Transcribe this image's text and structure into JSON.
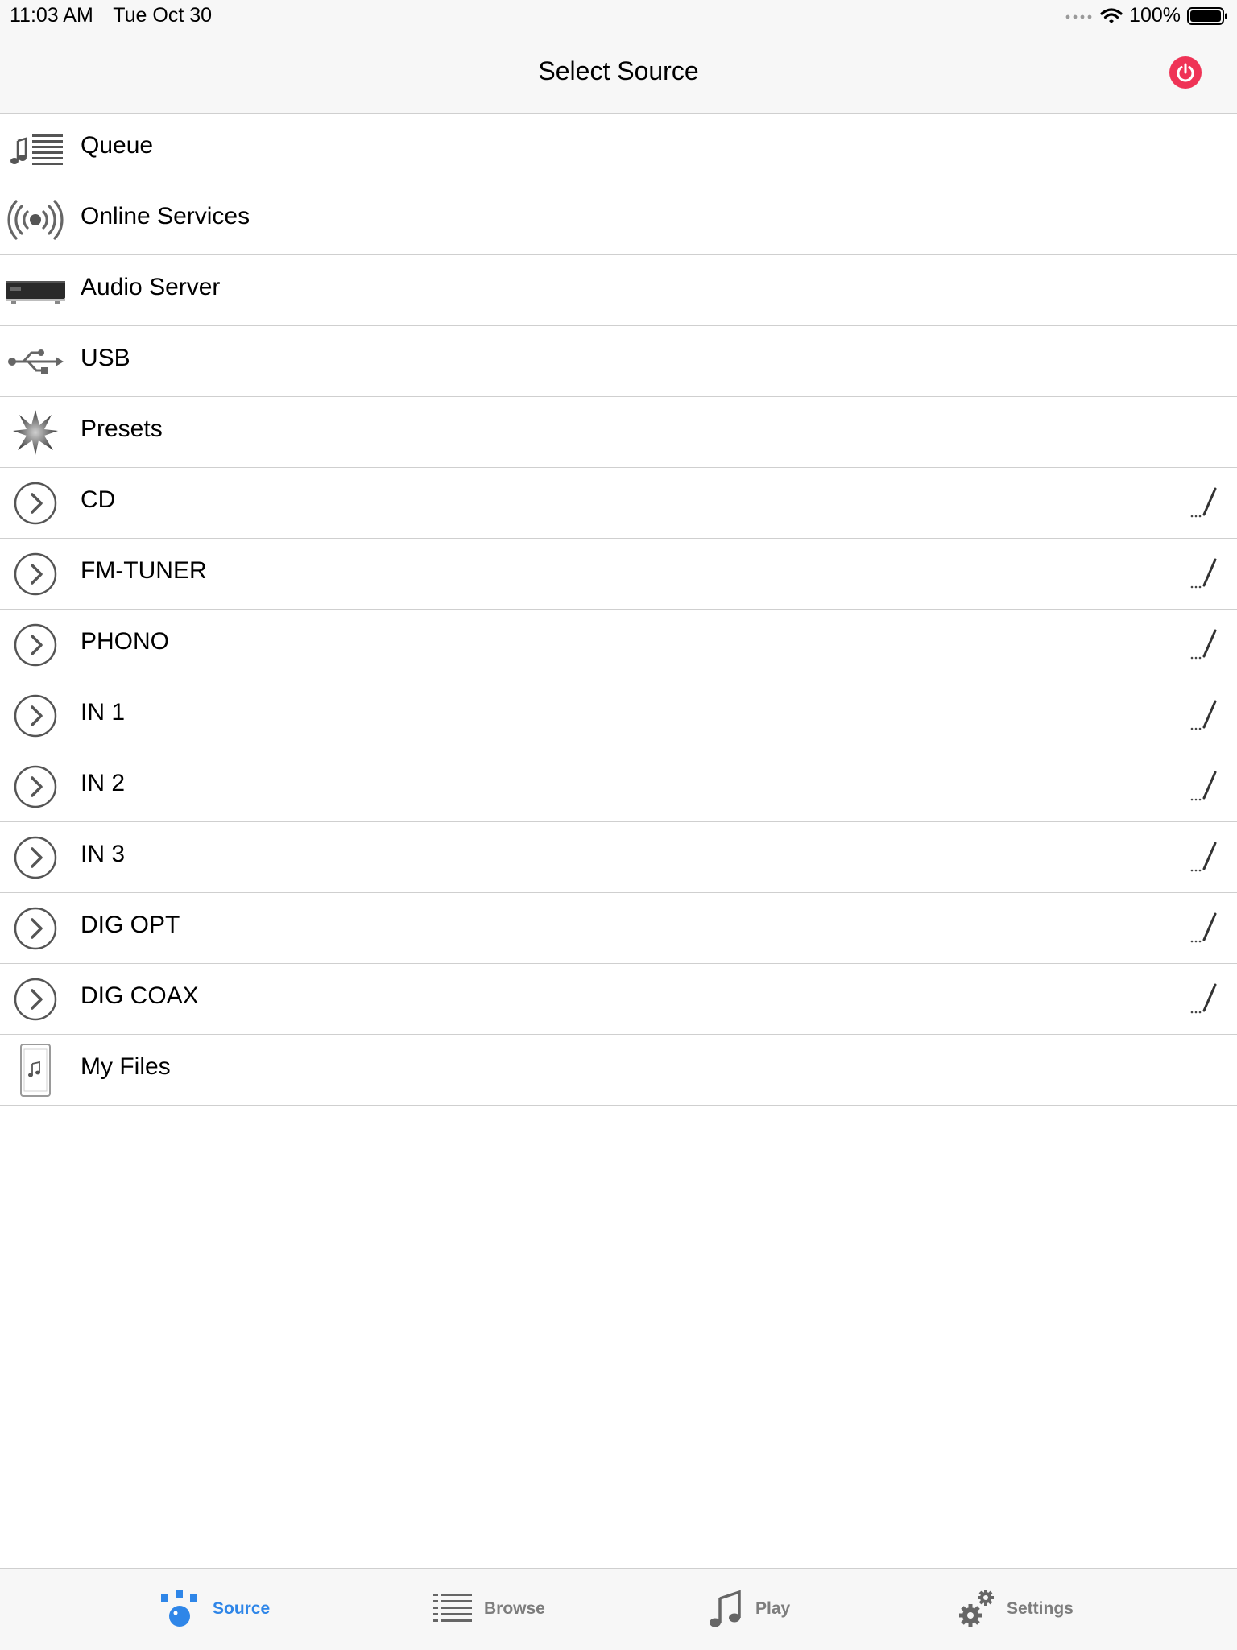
{
  "status": {
    "time": "11:03 AM",
    "date": "Tue Oct 30",
    "battery": "100%",
    "icons": [
      "signal-dots-icon",
      "wifi-icon",
      "battery-icon"
    ]
  },
  "nav": {
    "title": "Select Source",
    "power_icon": "power-icon",
    "power_color": "#ef3356"
  },
  "sources": [
    {
      "label": "Queue",
      "icon": "queue-icon"
    },
    {
      "label": "Online Services",
      "icon": "broadcast-icon"
    },
    {
      "label": "Audio Server",
      "icon": "audio-server-icon"
    },
    {
      "label": "USB",
      "icon": "usb-icon"
    },
    {
      "label": "Presets",
      "icon": "star-burst-icon"
    },
    {
      "label": "CD",
      "icon": "chevron-right-circle-icon",
      "editable": true
    },
    {
      "label": "FM-TUNER",
      "icon": "chevron-right-circle-icon",
      "editable": true
    },
    {
      "label": "PHONO",
      "icon": "chevron-right-circle-icon",
      "editable": true
    },
    {
      "label": "IN 1",
      "icon": "chevron-right-circle-icon",
      "editable": true
    },
    {
      "label": "IN 2",
      "icon": "chevron-right-circle-icon",
      "editable": true
    },
    {
      "label": "IN 3",
      "icon": "chevron-right-circle-icon",
      "editable": true
    },
    {
      "label": "DIG OPT",
      "icon": "chevron-right-circle-icon",
      "editable": true
    },
    {
      "label": "DIG COAX",
      "icon": "chevron-right-circle-icon",
      "editable": true
    },
    {
      "label": "My Files",
      "icon": "my-files-icon"
    }
  ],
  "tabs": [
    {
      "label": "Source",
      "icon": "source-icon",
      "active": true
    },
    {
      "label": "Browse",
      "icon": "browse-list-icon",
      "active": false
    },
    {
      "label": "Play",
      "icon": "music-note-icon",
      "active": false
    },
    {
      "label": "Settings",
      "icon": "gears-icon",
      "active": false
    }
  ],
  "colors": {
    "accent": "#2f86e8",
    "inactive": "#7d7d7d",
    "separator": "#cfcfcf"
  }
}
